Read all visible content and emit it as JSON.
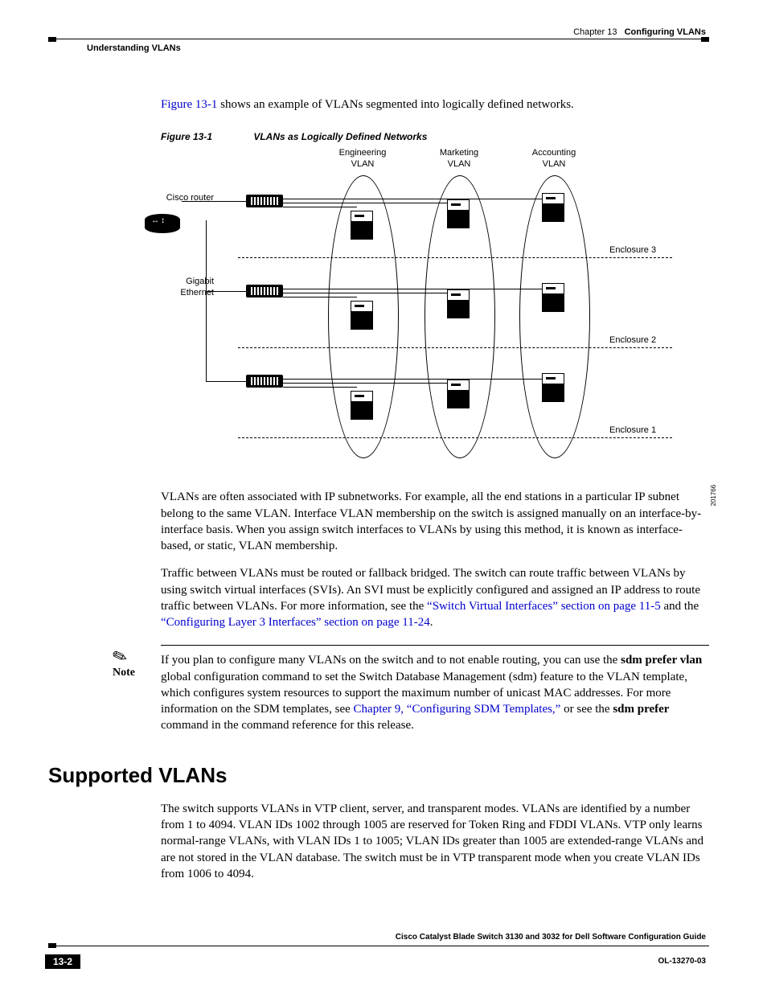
{
  "header": {
    "chapter_prefix": "Chapter 13",
    "chapter_title": "Configuring VLANs",
    "section": "Understanding VLANs"
  },
  "intro_link": "Figure 13-1",
  "intro_rest": " shows an example of VLANs segmented into logically defined networks.",
  "figure": {
    "id": "Figure 13-1",
    "title": "VLANs as Logically Defined Networks",
    "labels": {
      "eng1": "Engineering",
      "eng2": "VLAN",
      "mkt1": "Marketing",
      "mkt2": "VLAN",
      "acc1": "Accounting",
      "acc2": "VLAN",
      "router": "Cisco router",
      "ge1": "Gigabit",
      "ge2": "Ethernet",
      "enc3": "Enclosure 3",
      "enc2": "Enclosure 2",
      "enc1": "Enclosure 1",
      "imgnum": "201766"
    }
  },
  "para1": "VLANs are often associated with IP subnetworks. For example, all the end stations in a particular IP subnet belong to the same VLAN. Interface VLAN membership on the switch is assigned manually on an interface-by-interface basis. When you assign switch interfaces to VLANs by using this method, it is known as interface-based, or static, VLAN membership.",
  "para2_a": "Traffic between VLANs must be routed or fallback bridged. The switch can route traffic between VLANs by using switch virtual interfaces (SVIs). An SVI must be explicitly configured and assigned an IP address to route traffic between VLANs. For more information, see the ",
  "para2_link1": "“Switch Virtual Interfaces” section on page 11-5",
  "para2_b": " and the ",
  "para2_link2": "“Configuring Layer 3 Interfaces” section on page 11-24",
  "para2_c": ".",
  "note": {
    "label": "Note",
    "a": "If you plan to configure many VLANs on the switch and to not enable routing, you can use the ",
    "b1": "sdm prefer vlan",
    "c": " global configuration command to set the Switch Database Management (sdm) feature to the VLAN template, which configures system resources to support the maximum number of unicast MAC addresses. For more information on the SDM templates, see ",
    "link": "Chapter 9, “Configuring SDM Templates,”",
    "d": " or see the ",
    "b2": "sdm prefer",
    "e": " command in the command reference for this release."
  },
  "h2": "Supported VLANs",
  "para3": "The switch supports VLANs in VTP client, server, and transparent modes. VLANs are identified by a number from 1 to 4094. VLAN IDs 1002 through 1005 are reserved for Token Ring and FDDI VLANs. VTP only learns normal-range VLANs, with VLAN IDs 1 to 1005; VLAN IDs greater than 1005 are extended-range VLANs and are not stored in the VLAN database. The switch must be in VTP transparent mode when you create VLAN IDs from 1006 to 4094.",
  "footer": {
    "title": "Cisco Catalyst Blade Switch 3130 and 3032 for Dell Software Configuration Guide",
    "doc": "OL-13270-03",
    "page": "13-2"
  }
}
